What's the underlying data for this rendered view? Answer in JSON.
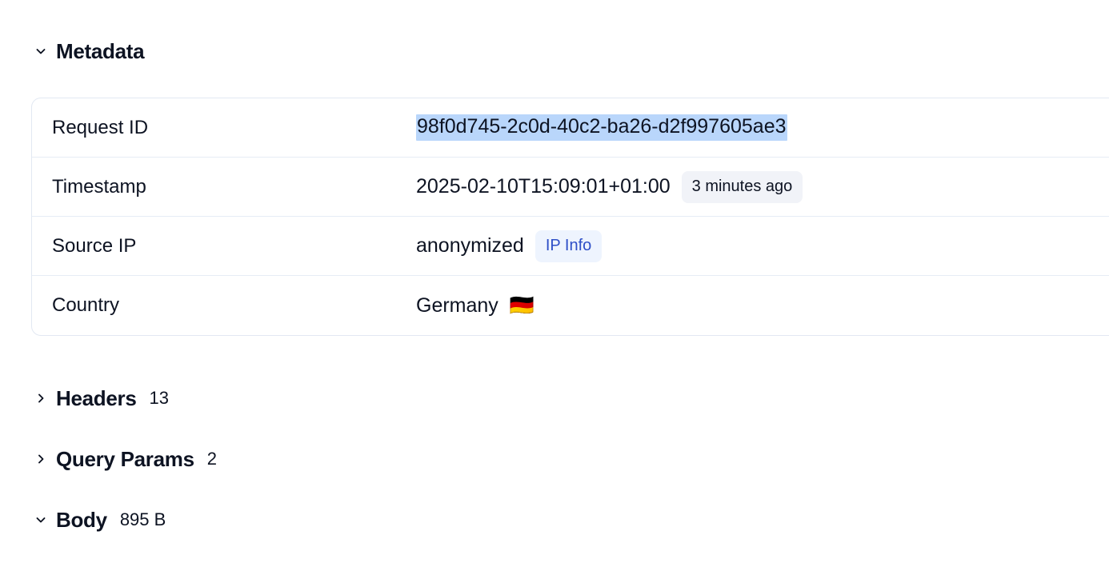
{
  "sections": {
    "metadata": {
      "title": "Metadata",
      "expanded": true,
      "chevron_icon": "chevron-down-icon",
      "rows": [
        {
          "label": "Request ID",
          "value": "98f0d745-2c0d-40c2-ba26-d2f997605ae3",
          "selected": true
        },
        {
          "label": "Timestamp",
          "value": "2025-02-10T15:09:01+01:00",
          "badge": "3 minutes ago"
        },
        {
          "label": "Source IP",
          "value": "anonymized",
          "badge": "IP Info"
        },
        {
          "label": "Country",
          "value": "Germany",
          "flag": "🇩🇪"
        }
      ]
    },
    "headers": {
      "title": "Headers",
      "count": "13",
      "expanded": false,
      "chevron_icon": "chevron-right-icon"
    },
    "query_params": {
      "title": "Query Params",
      "count": "2",
      "expanded": false,
      "chevron_icon": "chevron-right-icon"
    },
    "body": {
      "title": "Body",
      "count": "895 B",
      "expanded": true,
      "chevron_icon": "chevron-down-icon"
    }
  },
  "colors": {
    "text": "#0d1322",
    "border": "#e2e8f2",
    "row_divider": "#e6ecf5",
    "selection_highlight": "#b9d6fb",
    "badge_neutral_bg": "#f1f3f8",
    "badge_link_bg": "#eef4fe",
    "badge_link_text": "#2e4fc7"
  }
}
